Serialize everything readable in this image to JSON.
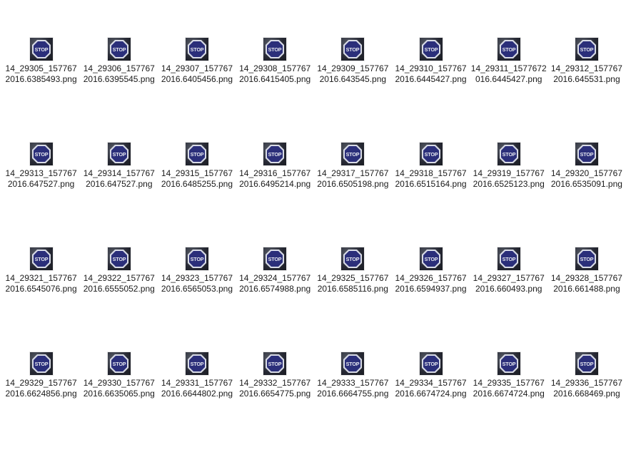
{
  "thumbnail_icon": "stop-sign-thumbnail",
  "files": [
    {
      "name": "14_29305_1577672016.6385493.png"
    },
    {
      "name": "14_29306_1577672016.6395545.png"
    },
    {
      "name": "14_29307_1577672016.6405456.png"
    },
    {
      "name": "14_29308_1577672016.6415405.png"
    },
    {
      "name": "14_29309_1577672016.643545.png"
    },
    {
      "name": "14_29310_1577672016.6445427.png"
    },
    {
      "name": "14_29311_1577672016.6445427.png"
    },
    {
      "name": "14_29312_1577672016.645531.png"
    },
    {
      "name": "14_29313_1577672016.647527.png"
    },
    {
      "name": "14_29314_1577672016.647527.png"
    },
    {
      "name": "14_29315_1577672016.6485255.png"
    },
    {
      "name": "14_29316_1577672016.6495214.png"
    },
    {
      "name": "14_29317_1577672016.6505198.png"
    },
    {
      "name": "14_29318_1577672016.6515164.png"
    },
    {
      "name": "14_29319_1577672016.6525123.png"
    },
    {
      "name": "14_29320_1577672016.6535091.png"
    },
    {
      "name": "14_29321_1577672016.6545076.png"
    },
    {
      "name": "14_29322_1577672016.6555052.png"
    },
    {
      "name": "14_29323_1577672016.6565053.png"
    },
    {
      "name": "14_29324_1577672016.6574988.png"
    },
    {
      "name": "14_29325_1577672016.6585116.png"
    },
    {
      "name": "14_29326_1577672016.6594937.png"
    },
    {
      "name": "14_29327_1577672016.660493.png"
    },
    {
      "name": "14_29328_1577672016.661488.png"
    },
    {
      "name": "14_29329_1577672016.6624856.png"
    },
    {
      "name": "14_29330_1577672016.6635065.png"
    },
    {
      "name": "14_29331_1577672016.6644802.png"
    },
    {
      "name": "14_29332_1577672016.6654775.png"
    },
    {
      "name": "14_29333_1577672016.6664755.png"
    },
    {
      "name": "14_29334_1577672016.6674724.png"
    },
    {
      "name": "14_29335_1577672016.6674724.png"
    },
    {
      "name": "14_29336_1577672016.668469.png"
    }
  ],
  "sign_text": "STOP",
  "colors": {
    "sign_fill": "#2b2f7a",
    "sign_border": "#d8dbe6",
    "sign_text": "#e6e8f0"
  }
}
